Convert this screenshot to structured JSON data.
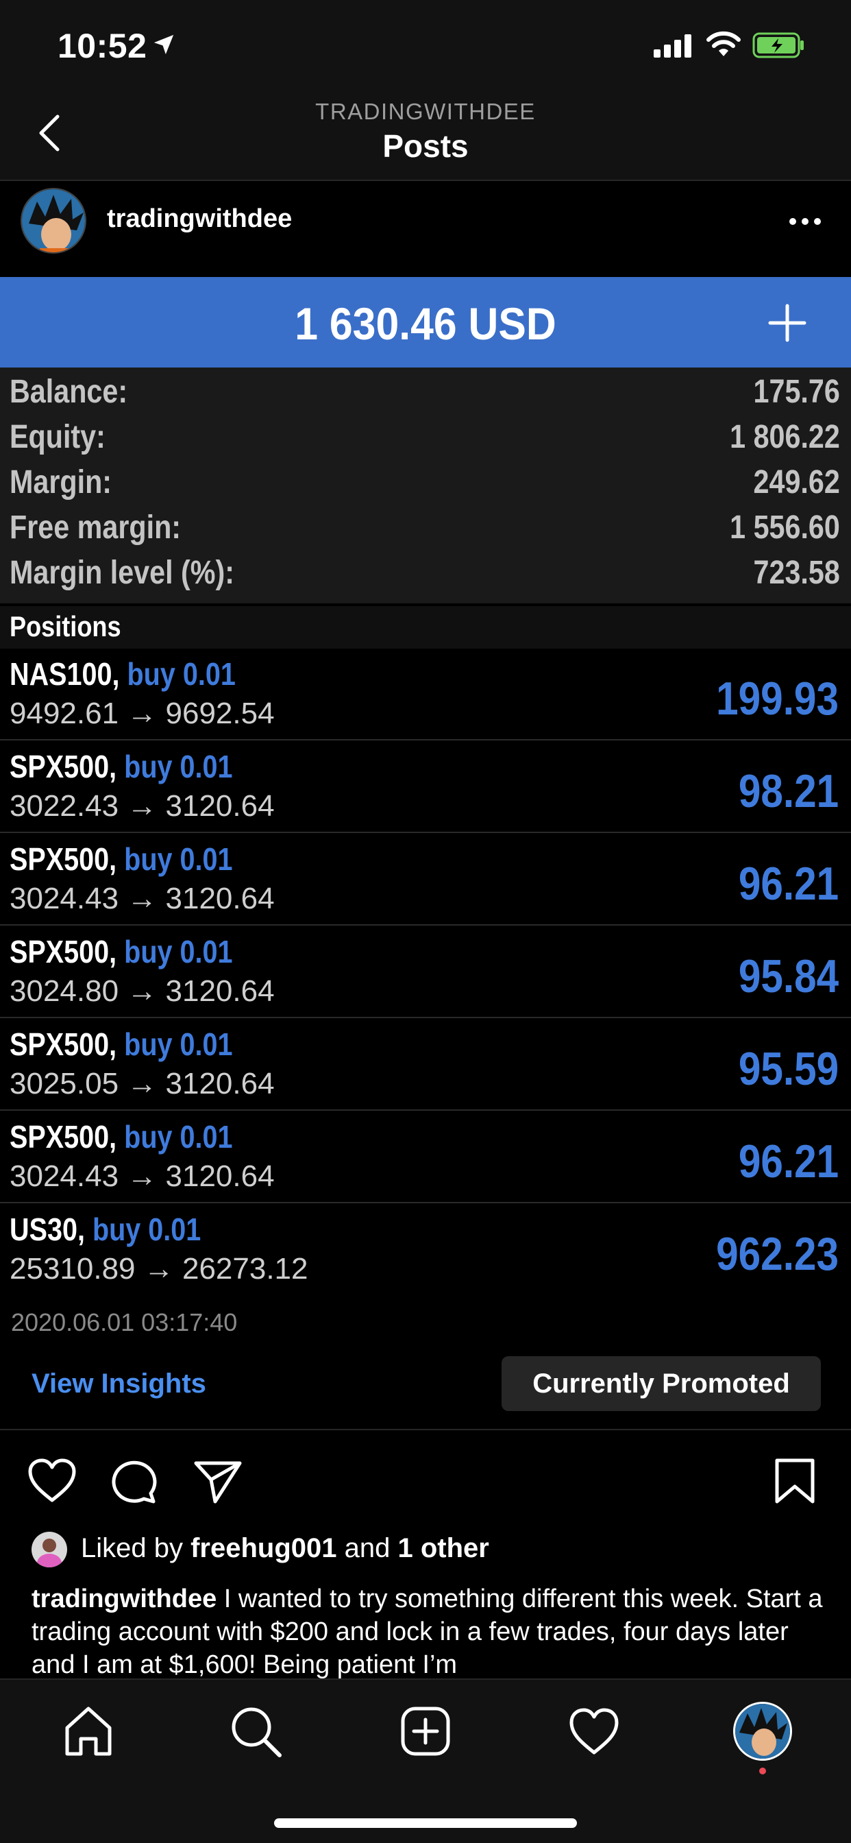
{
  "status_bar": {
    "time": "10:52"
  },
  "nav": {
    "subtitle": "TRADINGWITHDEE",
    "title": "Posts"
  },
  "post": {
    "username": "tradingwithdee"
  },
  "account": {
    "total": "1 630.46 USD",
    "summary": [
      {
        "label": "Balance:",
        "value": "175.76"
      },
      {
        "label": "Equity:",
        "value": "1 806.22"
      },
      {
        "label": "Margin:",
        "value": "249.62"
      },
      {
        "label": "Free margin:",
        "value": "1 556.60"
      },
      {
        "label": "Margin level (%):",
        "value": "723.58"
      }
    ],
    "positions_label": "Positions",
    "positions": [
      {
        "symbol": "NAS100,",
        "side": "buy 0.01",
        "prices": "9492.61 → 9692.54",
        "profit": "199.93"
      },
      {
        "symbol": "SPX500,",
        "side": "buy 0.01",
        "prices": "3022.43 → 3120.64",
        "profit": "98.21"
      },
      {
        "symbol": "SPX500,",
        "side": "buy 0.01",
        "prices": "3024.43 → 3120.64",
        "profit": "96.21"
      },
      {
        "symbol": "SPX500,",
        "side": "buy 0.01",
        "prices": "3024.80 → 3120.64",
        "profit": "95.84"
      },
      {
        "symbol": "SPX500,",
        "side": "buy 0.01",
        "prices": "3025.05 → 3120.64",
        "profit": "95.59"
      },
      {
        "symbol": "SPX500,",
        "side": "buy 0.01",
        "prices": "3024.43 → 3120.64",
        "profit": "96.21"
      },
      {
        "symbol": "US30,",
        "side": "buy 0.01",
        "prices": "25310.89 → 26273.12",
        "profit": "962.23"
      }
    ],
    "timestamp": "2020.06.01 03:17:40"
  },
  "insights": {
    "view_label": "View Insights",
    "promoted_label": "Currently Promoted"
  },
  "likes": {
    "prefix": "Liked by ",
    "user": "freehug001",
    "middle": " and ",
    "others": "1 other"
  },
  "caption": {
    "user": "tradingwithdee",
    "text": " I wanted to try something different this week. Start a trading account with $200 and lock in a few trades, four days later and I am at $1,600! Being patient I’m"
  },
  "colors": {
    "accent_blue": "#3f7bdc",
    "balance_bar": "#3a6fc9",
    "link_blue": "#4a8ff0"
  },
  "icons": [
    "location-arrow-icon",
    "signal-icon",
    "wifi-icon",
    "battery-icon",
    "back-chevron-icon",
    "more-icon",
    "plus-icon",
    "heart-icon",
    "comment-icon",
    "share-icon",
    "bookmark-icon",
    "home-icon",
    "search-icon",
    "add-post-icon",
    "activity-heart-icon"
  ]
}
